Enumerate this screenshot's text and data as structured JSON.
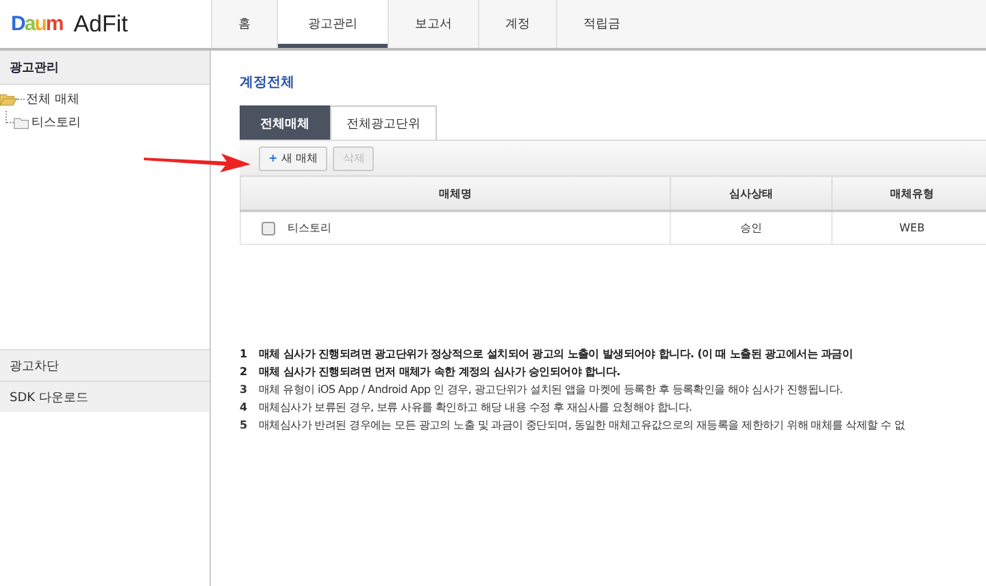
{
  "header": {
    "logo": "Daum",
    "product": "AdFit",
    "nav": [
      {
        "label": "홈",
        "selected": false
      },
      {
        "label": "광고관리",
        "selected": true
      },
      {
        "label": "보고서",
        "selected": false
      },
      {
        "label": "계정",
        "selected": false
      },
      {
        "label": "적립금",
        "selected": false
      }
    ]
  },
  "sidebar": {
    "title": "광고관리",
    "tree": [
      {
        "label": "전체 매체",
        "expanded": true,
        "children": [
          {
            "label": "티스토리"
          }
        ]
      }
    ],
    "sections": [
      "광고차단",
      "SDK 다운로드"
    ]
  },
  "content": {
    "title": "계정전체",
    "tabs": [
      {
        "label": "전체매체",
        "selected": true
      },
      {
        "label": "전체광고단위",
        "selected": false
      }
    ],
    "buttons": [
      {
        "label": "새 매체",
        "icon": "+",
        "disabled": false
      },
      {
        "label": "삭제",
        "disabled": true
      }
    ],
    "table": {
      "columns": [
        "매체명",
        "심사상태",
        "매체유형"
      ],
      "rows": [
        {
          "checked": false,
          "cells": [
            "티스토리",
            "승인",
            "WEB"
          ]
        }
      ]
    },
    "notes": [
      {
        "number": "1",
        "text": "매체 심사가 진행되려면 광고단위가 정상적으로 설치되어 광고의 노출이 발생되어야 합니다. (이 때 노출된 광고에서는 과금이",
        "bold": true
      },
      {
        "number": "2",
        "text": "매체 심사가 진행되려면 먼저 매체가 속한 계정의 심사가 승인되어야 합니다.",
        "bold": true
      },
      {
        "number": "3",
        "text": "매체 유형이 iOS App / Android App 인 경우, 광고단위가 설치된 앱을 마켓에 등록한 후 등록확인을 해야 심사가 진행됩니다.",
        "bold": false
      },
      {
        "number": "4",
        "text": "매체심사가 보류된 경우, 보류 사유를 확인하고 해당 내용 수정 후 재심사를 요청해야 합니다.",
        "bold": false
      },
      {
        "number": "5",
        "text": "매체심사가 반려된 경우에는 모든 광고의 노출 및 과금이 중단되며, 동일한 매체고유값으로의 재등록을 제한하기 위해 매체를 삭제할 수 없",
        "bold": false
      }
    ]
  }
}
